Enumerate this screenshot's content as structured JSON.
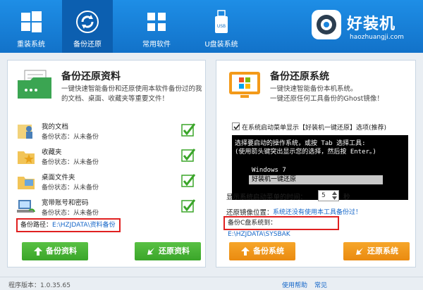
{
  "nav": {
    "items": [
      {
        "label": "重装系统"
      },
      {
        "label": "备份还原"
      },
      {
        "label": "常用软件"
      },
      {
        "label": "U盘装系统"
      }
    ],
    "active_index": 1
  },
  "brand": {
    "name": "好装机",
    "domain": "haozhuangji.com",
    "usb_icon_text": "USB"
  },
  "left": {
    "title": "备份还原资料",
    "desc_line1": "一键快速智能备份和还原使用本软件备份过的我",
    "desc_line2": "的文档、桌面、收藏夹等重要文件！",
    "items": [
      {
        "name": "我的文档",
        "status": "备份状态：从未备份"
      },
      {
        "name": "收藏夹",
        "status": "备份状态：从未备份"
      },
      {
        "name": "桌面文件夹",
        "status": "备份状态：从未备份"
      },
      {
        "name": "宽带账号和密码",
        "status": "备份状态：从未备份"
      }
    ],
    "path_label": "备份路径：",
    "path_value": "E:\\HZJDATA\\资料备份",
    "backup_button": "备份资料",
    "restore_button": "还原资料"
  },
  "right": {
    "title": "备份还原系统",
    "desc_line1": "一键快速智能备份本机系统。",
    "desc_line2": "一键还原任何工具备份的Ghost镜像！",
    "boot_menu_checkbox_label": "在系统启动菜单显示【好装机一键还原】选项(推荐)",
    "terminal_line1": "选择要启动的操作系统，或按 Tab 选择工具:",
    "terminal_line2": "(使用箭头键突出显示您的选择，然后按 Enter。)",
    "terminal_os1": "Windows 7",
    "terminal_os2": "好装机一键还原",
    "boot_time_label": "显示系统启动菜单的时间：",
    "boot_time_value": "5",
    "boot_time_unit": "秒",
    "restore_image_label": "还原镜像位置：",
    "restore_image_value": "系统还没有使用本工具备份过！",
    "backup_to_label": "备份C盘系统到：",
    "backup_to_value": "E:\\HZJDATA\\SYSBAK",
    "backup_button": "备份系统",
    "restore_button": "还原系统"
  },
  "footer": {
    "version": "程序版本：1.0.35.65",
    "help": "使用帮助",
    "faq": "常见"
  },
  "colors": {
    "topbar": "#1a84dc",
    "active_nav": "#0c5fb0",
    "green_button": "#4cb537",
    "orange_button": "#f09a1d",
    "highlight_box": "#e02020",
    "link": "#1466c8"
  }
}
